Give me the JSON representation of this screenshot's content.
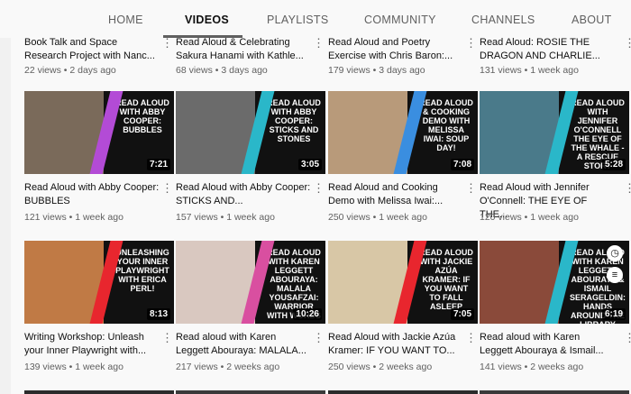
{
  "tabs": [
    {
      "label": "HOME"
    },
    {
      "label": "VIDEOS"
    },
    {
      "label": "PLAYLISTS"
    },
    {
      "label": "COMMUNITY"
    },
    {
      "label": "CHANNELS"
    },
    {
      "label": "ABOUT"
    }
  ],
  "active_tab": "VIDEOS",
  "top_row": [
    {
      "title": "Book Talk and Space Research Project with Nanc...",
      "views": "22 views",
      "age": "2 days ago"
    },
    {
      "title": "Read Aloud & Celebrating Sakura Hanami with Kathle...",
      "views": "68 views",
      "age": "3 days ago"
    },
    {
      "title": "Read Aloud and Poetry Exercise with Chris Baron:...",
      "views": "179 views",
      "age": "3 days ago"
    },
    {
      "title": "Read Aloud: ROSIE THE DRAGON AND CHARLIE...",
      "views": "131 views",
      "age": "1 week ago"
    }
  ],
  "row1": [
    {
      "title": "Read Aloud with Abby Cooper: BUBBLES",
      "views": "121 views",
      "age": "1 week ago",
      "duration": "7:21",
      "promo": "READ ALOUD WITH ABBY COOPER: BUBBLES",
      "stripe": "#b34bd6",
      "photo": "#7a6a5a"
    },
    {
      "title": "Read Aloud with Abby Cooper: STICKS AND...",
      "views": "157 views",
      "age": "1 week ago",
      "duration": "3:05",
      "promo": "READ ALOUD WITH ABBY COOPER: STICKS AND STONES",
      "stripe": "#2ab7c9",
      "photo": "#6b6b6b"
    },
    {
      "title": "Read Aloud and Cooking Demo with Melissa Iwai:...",
      "views": "250 views",
      "age": "1 week ago",
      "duration": "7:08",
      "promo": "READ ALOUD & COOKING DEMO WITH MELISSA IWAI: SOUP DAY!",
      "stripe": "#3a8ee0",
      "photo": "#b89a7a"
    },
    {
      "title": "Read Aloud with Jennifer O'Connell: THE EYE OF THE...",
      "views": "120 views",
      "age": "1 week ago",
      "duration": "5:28",
      "promo": "READ ALOUD WITH JENNIFER O'CONNELL THE EYE OF THE WHALE - A RESCUE STORY",
      "stripe": "#2ab7c9",
      "photo": "#4a7a8a"
    }
  ],
  "row2": [
    {
      "title": "Writing Workshop: Unleash your Inner Playwright with...",
      "views": "139 views",
      "age": "1 week ago",
      "duration": "8:13",
      "promo": "UNLEASHING YOUR INNER PLAYWRIGHT WITH ERICA PERL!",
      "stripe": "#e8262e",
      "photo": "#c07a45"
    },
    {
      "title": "Read aloud with Karen Leggett Abouraya: MALALA...",
      "views": "217 views",
      "age": "2 weeks ago",
      "duration": "10:26",
      "promo": "READ ALOUD WITH KAREN LEGGETT ABOURAYA: MALALA YOUSAFZAI: WARRIOR WITH WORDS",
      "stripe": "#d94fa0",
      "photo": "#d9c8c0"
    },
    {
      "title": "Read Aloud with Jackie Azúa Kramer: IF YOU WANT TO...",
      "views": "250 views",
      "age": "2 weeks ago",
      "duration": "7:05",
      "promo": "READ ALOUD WITH JACKIE AZÚA KRAMER: IF YOU WANT TO FALL ASLEEP",
      "stripe": "#e8262e",
      "photo": "#d8c7a6"
    },
    {
      "title": "Read aloud with Karen Leggett Abouraya & Ismail...",
      "views": "141 views",
      "age": "2 weeks ago",
      "duration": "6:19",
      "promo": "READ ALOUD WITH KAREN LEGGETT ABOURAYA & ISMAIL SERAGELDIN: HANDS AROUND THE LIBRARY",
      "stripe": "#2ab7c9",
      "photo": "#8a4a3a"
    }
  ],
  "icons": {
    "kebab": "more-vertical-icon",
    "clock": "clock-icon",
    "queue": "add-to-queue-icon"
  },
  "colors": {
    "background": "#f9f9f9",
    "text_primary": "#0f0f0f",
    "text_secondary": "#606060"
  }
}
